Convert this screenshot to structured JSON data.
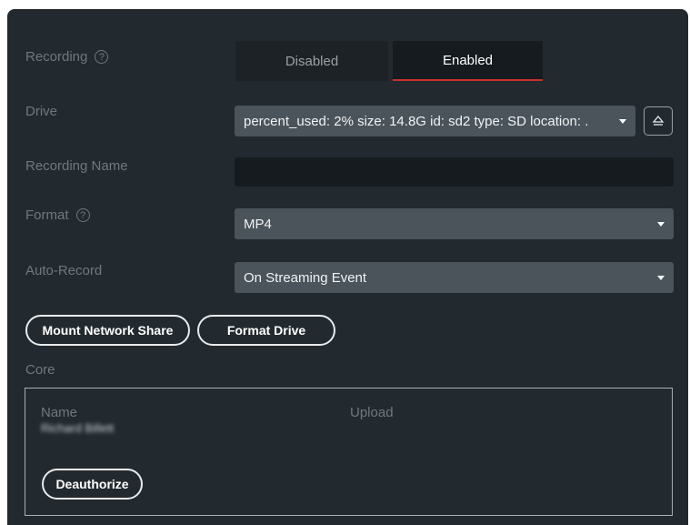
{
  "recording": {
    "label": "Recording",
    "help_icon": "?",
    "options": [
      "Disabled",
      "Enabled"
    ],
    "selected": "Enabled"
  },
  "drive": {
    "label": "Drive",
    "value": "percent_used: 2% size: 14.8G id: sd2 type: SD location: .",
    "eject_icon": "eject-icon"
  },
  "recording_name": {
    "label": "Recording Name",
    "value": ""
  },
  "format": {
    "label": "Format",
    "help_icon": "?",
    "value": "MP4"
  },
  "auto_record": {
    "label": "Auto-Record",
    "value": "On Streaming Event"
  },
  "actions": {
    "mount_label": "Mount Network Share",
    "format_label": "Format Drive"
  },
  "core": {
    "label": "Core",
    "name_header": "Name",
    "upload_header": "Upload",
    "name_value": "Richard Billett",
    "deauthorize_label": "Deauthorize"
  },
  "colors": {
    "panel_bg": "#232a2f",
    "select_bg": "#4b545b",
    "accent_red": "#c9302c"
  }
}
